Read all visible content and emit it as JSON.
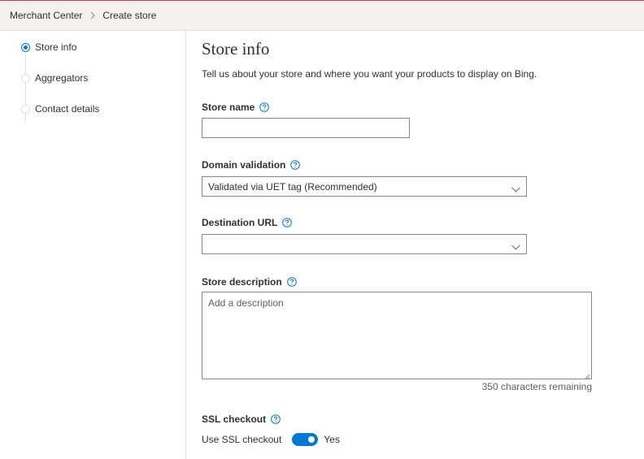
{
  "breadcrumb": {
    "items": [
      "Merchant Center",
      "Create store"
    ]
  },
  "steps": [
    {
      "label": "Store info",
      "active": true
    },
    {
      "label": "Aggregators",
      "active": false
    },
    {
      "label": "Contact details",
      "active": false
    }
  ],
  "form": {
    "title": "Store info",
    "subtitle": "Tell us about your store and where you want your products to display on Bing.",
    "store_name": {
      "label": "Store name",
      "value": ""
    },
    "domain_validation": {
      "label": "Domain validation",
      "value": "Validated via UET tag (Recommended)"
    },
    "destination_url": {
      "label": "Destination URL",
      "value": ""
    },
    "store_description": {
      "label": "Store description",
      "placeholder": "Add a description",
      "remaining": "350 characters remaining"
    },
    "ssl_checkout": {
      "label": "SSL checkout",
      "toggle_label": "Use SSL checkout",
      "state": "Yes",
      "on": true
    }
  },
  "colors": {
    "accent": "#0078d4",
    "top_border": "#d13438"
  },
  "icons": {
    "help": "question-circle-icon",
    "chevron": "chevron-down-icon",
    "separator": "chevron-right-icon"
  }
}
